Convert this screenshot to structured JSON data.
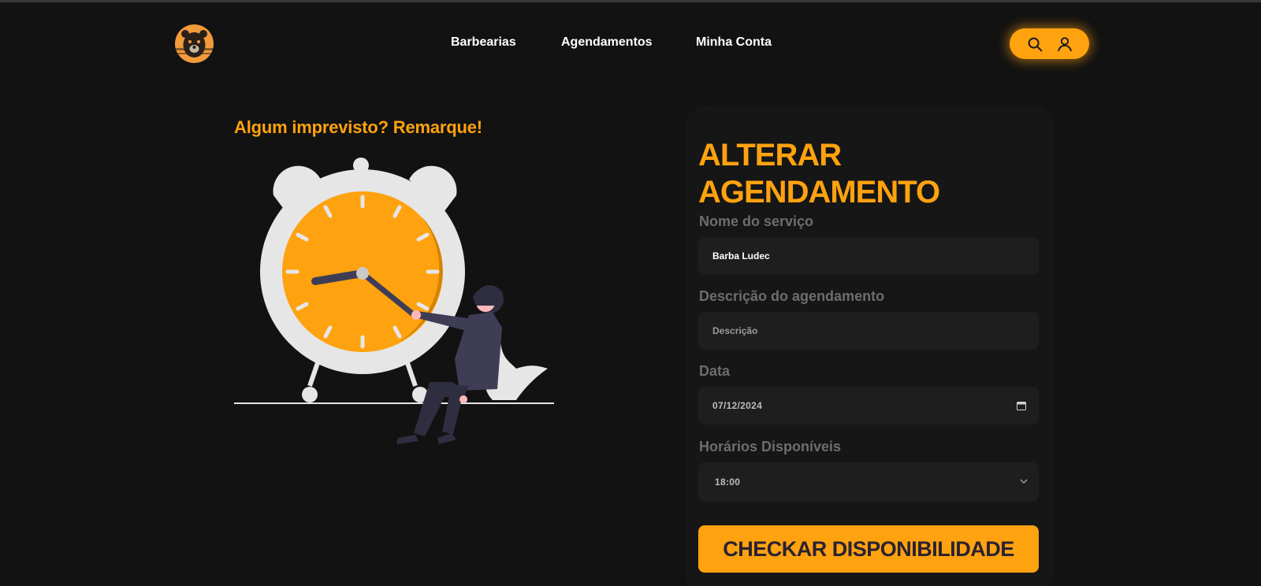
{
  "header": {
    "logo_icon": "bear-logo-icon",
    "nav": [
      {
        "label": "Barbearias"
      },
      {
        "label": "Agendamentos"
      },
      {
        "label": "Minha Conta"
      }
    ],
    "actions": [
      {
        "icon": "search-icon"
      },
      {
        "icon": "user-icon"
      }
    ]
  },
  "promo": {
    "title": "Algum imprevisto? Remarque!",
    "illustration": "alarm-clock-woman-illustration"
  },
  "form": {
    "title": "ALTERAR AGENDAMENTO",
    "service": {
      "label": "Nome do serviço",
      "value": "Barba Ludec"
    },
    "description": {
      "label": "Descrição do agendamento",
      "placeholder": "Descrição"
    },
    "date": {
      "label": "Data",
      "value": "07/12/2024"
    },
    "time": {
      "label": "Horários Disponíveis",
      "selected": "18:00"
    },
    "submit_label": "CHECKAR DISPONIBILIDADE"
  },
  "colors": {
    "accent": "#ffa20f",
    "background": "#121212",
    "field": "#1e1e1e",
    "label": "#6d6d6d"
  }
}
